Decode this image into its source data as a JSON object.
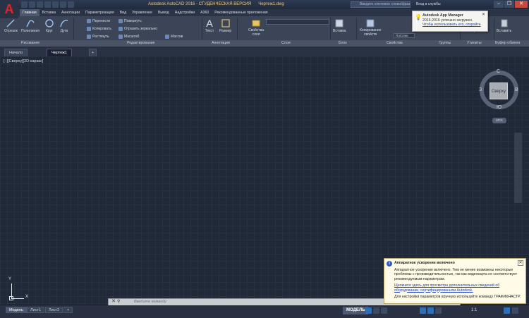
{
  "app": {
    "title": "Autodesk AutoCAD 2016 - СТУДЕНЧЕСКАЯ ВЕРСИЯ",
    "file": "Чертеж1.dwg",
    "search_placeholder": "Введите ключевое слово/фразу",
    "user": "Вход в службы",
    "window_controls": [
      "–",
      "❐",
      "✕"
    ]
  },
  "menu": {
    "items": [
      "Главная",
      "Вставка",
      "Аннотации",
      "Параметризация",
      "Вид",
      "Управление",
      "Вывод",
      "Надстройки",
      "A360",
      "Рекомендованные приложения"
    ],
    "active_index": 0
  },
  "ribbon": {
    "draw": {
      "line": "Отрезок",
      "polyline": "Полилиния",
      "circle": "Круг",
      "arc": "Дуга"
    },
    "modify": {
      "move": "Перенести",
      "rotate": "Повернуть",
      "copy": "Копировать",
      "mirror": "Отразить зеркально",
      "stretch": "Растянуть",
      "scale": "Масштаб",
      "array": "Массив"
    },
    "annotation": {
      "text": "Текст",
      "dimension": "Размер"
    },
    "layers": {
      "properties": "Свойства слоя"
    },
    "block": {
      "insert": "Вставка"
    },
    "properties": {
      "match": "Копирование свойств",
      "layer_value": "ПоСлою"
    },
    "utilities": {
      "measure": "Измерить"
    },
    "clipboard": {
      "paste": "Вставить"
    },
    "panel_labels": [
      "Рисование",
      "Редактирование",
      "Аннотации",
      "Слои",
      "Блок",
      "Свойства",
      "Группы",
      "Утилиты",
      "Буфер обмена"
    ]
  },
  "tabs": {
    "items": [
      "Начало",
      "Чертеж1"
    ],
    "active_index": 1,
    "add": "+"
  },
  "viewport": {
    "label": "[–][Сверху][2D-каркас]",
    "viewcube": {
      "top": "Сверху",
      "north": "С",
      "south": "Ю",
      "west": "З",
      "east": "В"
    },
    "wcs": "МСК"
  },
  "ucs": {
    "x": "X",
    "y": "Y"
  },
  "command_line": {
    "placeholder": "Введите команду",
    "close": "✕"
  },
  "status": {
    "layouts": [
      "Модель",
      "Лист1",
      "Лист2"
    ],
    "active_layout": 0,
    "add_layout": "+",
    "model": "МОДЕЛЬ",
    "scale": "1:1"
  },
  "notification": {
    "title": "Аппаратное ускорение включено",
    "body": "Аппаратное ускорение включено. Тем не менее возможны некоторые проблемы с производительностью, так как видеокарта не соответствует рекомендуемым параметрам.",
    "link": "Щелкните здесь для просмотра дополнительных сведений об оборудовании, сертифицированном Autodesk.",
    "footer": "Для настройки параметров вручную используйте команду ГРАФИКНАСТР."
  },
  "app_manager": {
    "title": "Autodesk App Manager",
    "line1": "2016-2016 успешно загружен.",
    "link": "Чтобы использовать его, откройте"
  },
  "colors": {
    "accent": "#2f6fb5",
    "logo": "#e0242a",
    "canvas": "#212836",
    "notification": "#fffbe6"
  }
}
